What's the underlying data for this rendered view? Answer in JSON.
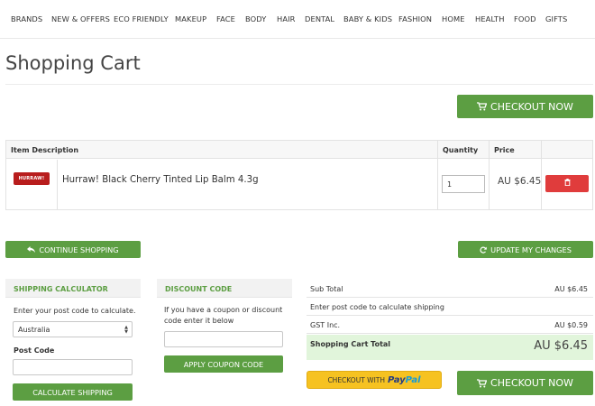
{
  "nav": {
    "items": [
      "BRANDS",
      "NEW & OFFERS",
      "ECO FRIENDLY",
      "MAKEUP",
      "FACE",
      "BODY",
      "HAIR",
      "DENTAL",
      "BABY & KIDS",
      "FASHION",
      "HOME",
      "HEALTH",
      "FOOD",
      "GIFTS"
    ]
  },
  "page": {
    "title": "Shopping Cart"
  },
  "buttons": {
    "checkout_top": "CHECKOUT NOW",
    "continue_shopping": "CONTINUE SHOPPING",
    "update_changes": "UPDATE MY CHANGES",
    "calculate_shipping": "CALCULATE SHIPPING",
    "apply_coupon": "APPLY COUPON CODE",
    "checkout_bottom": "CHECKOUT NOW",
    "paypal_prefix": "CHECKOUT WITH",
    "paypal_logo_a": "Pay",
    "paypal_logo_b": "Pal"
  },
  "cart_table": {
    "headers": {
      "item": "Item Description",
      "quantity": "Quantity",
      "price": "Price"
    },
    "rows": [
      {
        "thumb_text": "HURRAW!",
        "name": "Hurraw! Black Cherry Tinted Lip Balm 4.3g",
        "quantity": "1",
        "price": "AU $6.45"
      }
    ]
  },
  "shipping": {
    "title": "SHIPPING CALCULATOR",
    "instruction": "Enter your post code to calculate.",
    "country": "Australia",
    "postcode_label": "Post Code",
    "postcode_value": ""
  },
  "discount": {
    "title": "DISCOUNT CODE",
    "instruction": "If you have a coupon or discount code enter it below",
    "code_value": ""
  },
  "summary": {
    "subtotal_label": "Sub Total",
    "subtotal_value": "AU $6.45",
    "shipping_note": "Enter post code to calculate shipping",
    "gst_label": "GST Inc.",
    "gst_value": "AU $0.59",
    "total_label": "Shopping Cart Total",
    "total_value": "AU $6.45"
  },
  "colors": {
    "accent_green": "#5c9e42",
    "delete_red": "#e03c3c",
    "paypal_yellow": "#f6c221",
    "total_bg": "#e1f5db"
  },
  "icons": {
    "cart": "cart-icon",
    "back": "reply-arrow-icon",
    "refresh": "refresh-icon",
    "delete": "trash-icon"
  }
}
